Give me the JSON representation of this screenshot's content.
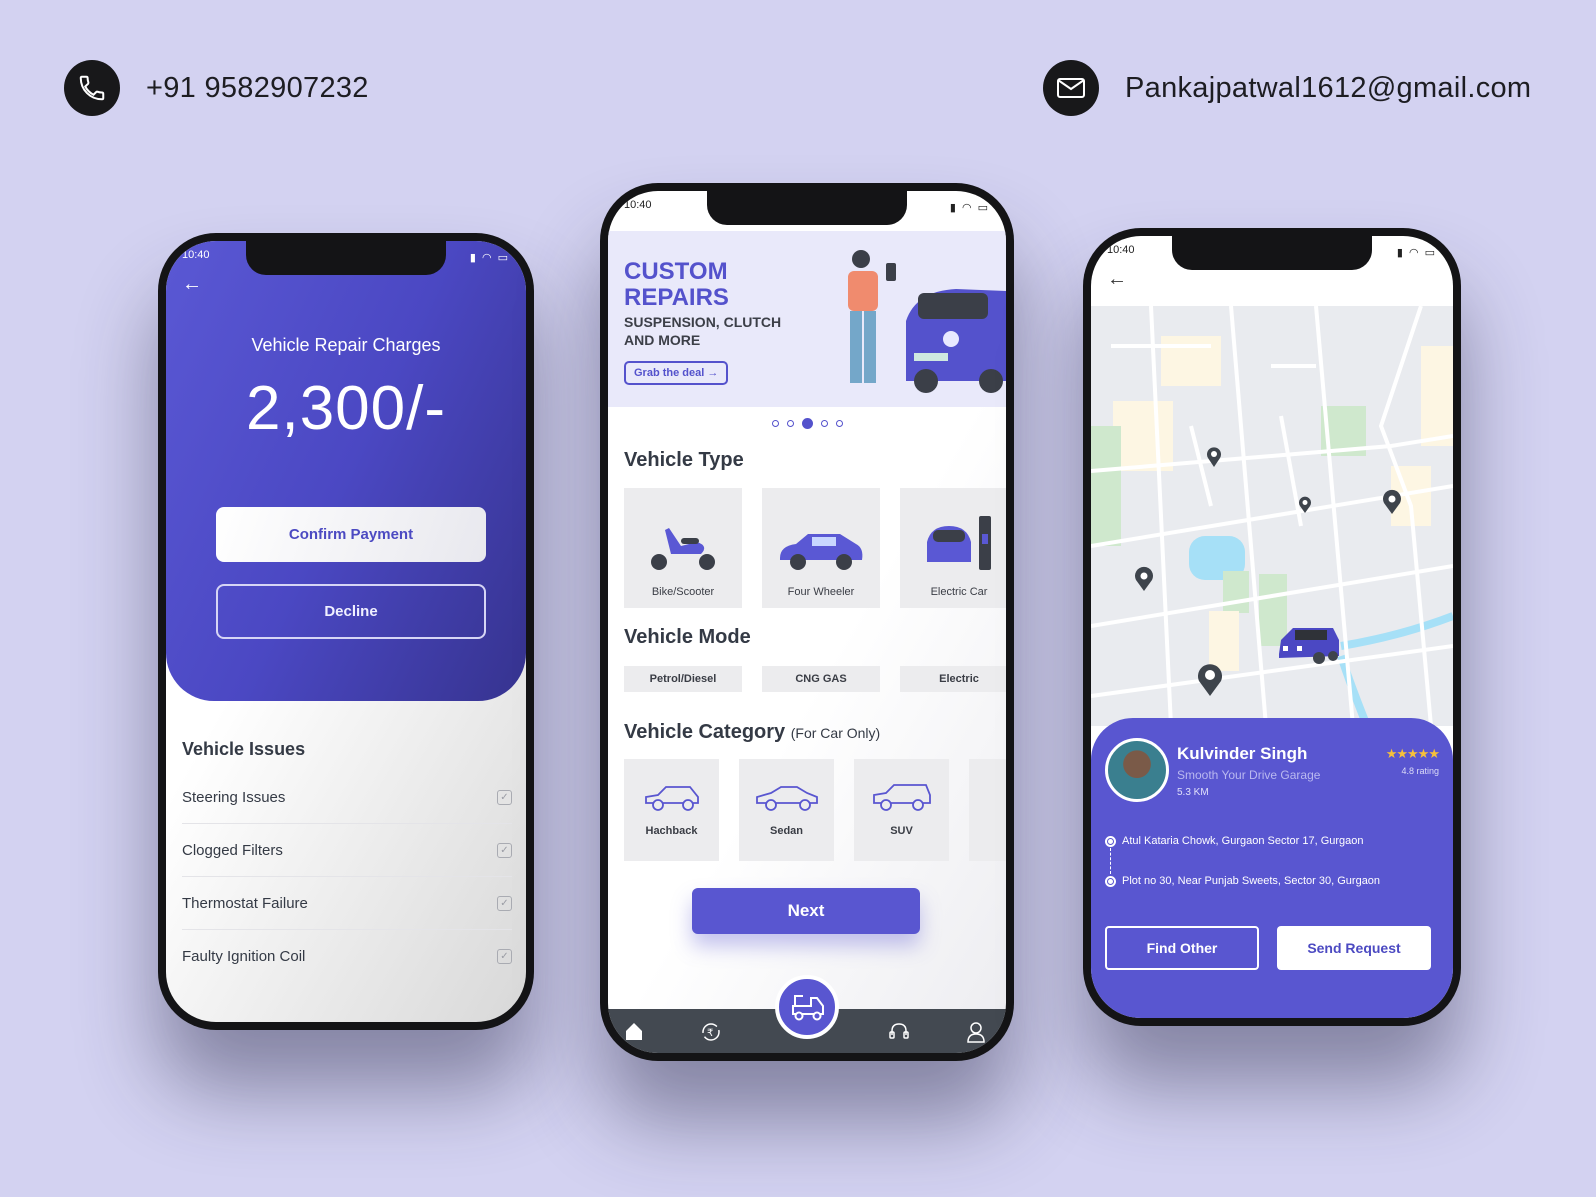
{
  "contact": {
    "phone": "+91 9582907232",
    "email": "Pankajpatwal1612@gmail.com"
  },
  "colors": {
    "background": "#d3d2f1",
    "accent": "#5956d0",
    "navbar": "#434951",
    "star": "#f6c13b"
  },
  "status_bar": {
    "time": "10:40"
  },
  "payment_screen": {
    "title": "Vehicle Repair Charges",
    "amount": "2,300/-",
    "confirm_label": "Confirm Payment",
    "decline_label": "Decline",
    "issues_title": "Vehicle Issues",
    "issues": [
      {
        "label": "Steering Issues",
        "checked": true
      },
      {
        "label": "Clogged Filters",
        "checked": true
      },
      {
        "label": "Thermostat Failure",
        "checked": true
      },
      {
        "label": "Faulty Ignition Coil",
        "checked": true
      }
    ]
  },
  "home_screen": {
    "banner": {
      "headline": "CUSTOM REPAIRS",
      "subline": "SUSPENSION, CLUTCH AND MORE",
      "cta": "Grab the deal"
    },
    "carousel": {
      "count": 5,
      "active_index": 2
    },
    "vehicle_type_title": "Vehicle Type",
    "vehicle_types": [
      "Bike/Scooter",
      "Four Wheeler",
      "Electric Car"
    ],
    "vehicle_mode_title": "Vehicle Mode",
    "vehicle_modes": [
      "Petrol/Diesel",
      "CNG GAS",
      "Electric"
    ],
    "vehicle_category_title": "Vehicle Category",
    "vehicle_category_note": "(For Car Only)",
    "vehicle_categories": [
      "Hachback",
      "Sedan",
      "SUV"
    ],
    "next_label": "Next",
    "nav": [
      "home-icon",
      "rupee-refresh-icon",
      "tow-truck-icon",
      "headset-icon",
      "user-icon"
    ]
  },
  "map_screen": {
    "garage": {
      "name": "Kulvinder Singh",
      "business": "Smooth Your Drive Garage",
      "distance": "5.3 KM",
      "stars": "★★★★★",
      "rating": "4.8 rating"
    },
    "route": {
      "from": "Atul Kataria Chowk, Gurgaon Sector 17, Gurgaon",
      "to": "Plot no 30, Near Punjab Sweets, Sector 30, Gurgaon"
    },
    "find_other_label": "Find Other",
    "send_request_label": "Send Request"
  }
}
